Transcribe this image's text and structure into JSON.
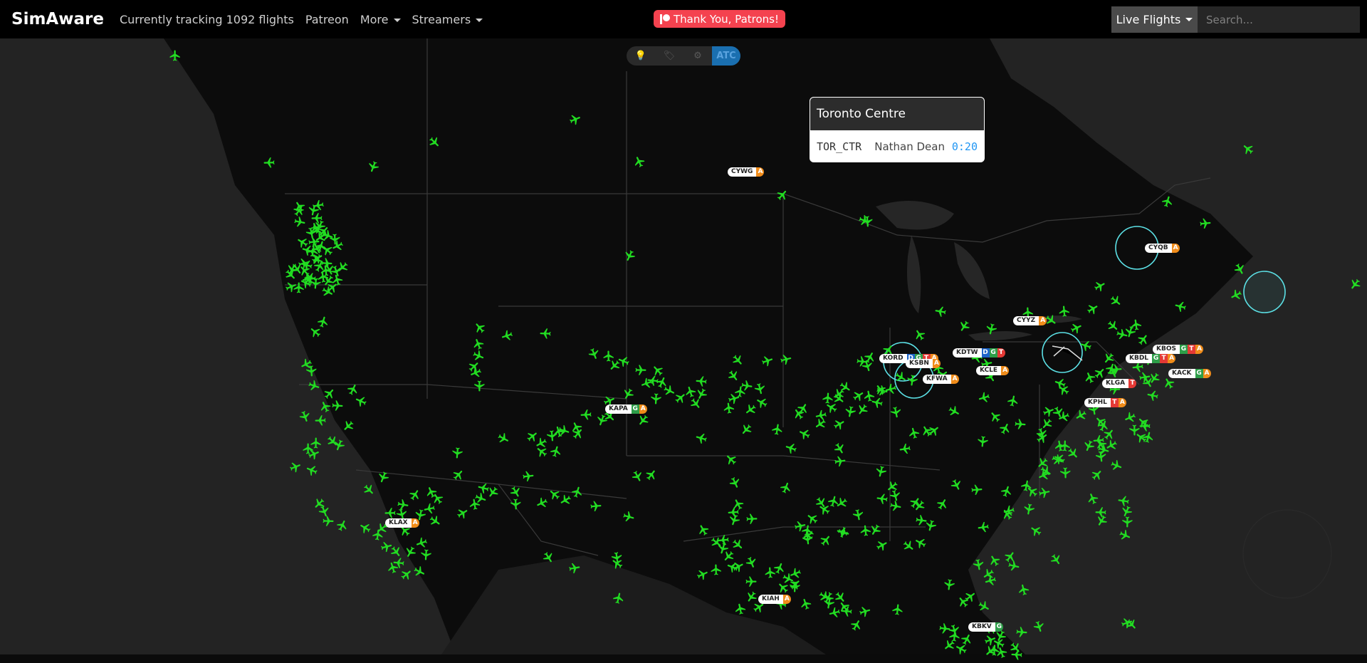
{
  "navbar": {
    "brand": "SimAware",
    "tracking": "Currently tracking 1092 flights",
    "patreon": "Patreon",
    "more": "More",
    "streamers": "Streamers",
    "patron_button": "Thank You, Patrons!",
    "live_flights": "Live Flights",
    "search_placeholder": "Search..."
  },
  "map_toggles": [
    "bulb-icon",
    "tags-icon",
    "gear-icon",
    "ATC"
  ],
  "popup": {
    "title": "Toronto Centre",
    "callsign": "TOR_CTR",
    "controller": "Nathan Dean",
    "time": "0:20"
  },
  "airports": [
    {
      "code": "CYWG",
      "badges": [
        "A"
      ]
    },
    {
      "code": "CYQB",
      "badges": [
        "A"
      ]
    },
    {
      "code": "CYYZ",
      "badges": [
        "A"
      ]
    },
    {
      "code": "KORD",
      "badges": [
        "D",
        "G",
        "T",
        "A"
      ]
    },
    {
      "code": "KSBN",
      "badges": [
        "A"
      ]
    },
    {
      "code": "KDTW",
      "badges": [
        "D",
        "G",
        "T"
      ]
    },
    {
      "code": "KFWA",
      "badges": [
        "A"
      ]
    },
    {
      "code": "KCLE",
      "badges": [
        "A"
      ]
    },
    {
      "code": "KBOS",
      "badges": [
        "G",
        "T",
        "A"
      ]
    },
    {
      "code": "KBDL",
      "badges": [
        "G",
        "T",
        "A"
      ]
    },
    {
      "code": "KACK",
      "badges": [
        "G",
        "A"
      ]
    },
    {
      "code": "KLGA",
      "badges": [
        "T"
      ]
    },
    {
      "code": "KPHL",
      "badges": [
        "T",
        "A"
      ]
    },
    {
      "code": "KAPA",
      "badges": [
        "G",
        "A"
      ]
    },
    {
      "code": "KLAX",
      "badges": [
        "A"
      ]
    },
    {
      "code": "KIAH",
      "badges": [
        "A"
      ]
    },
    {
      "code": "KBKV",
      "badges": [
        "G"
      ]
    }
  ],
  "colors": {
    "plane": "#22dd22",
    "atc_circle": "#5ce1e6",
    "badge_A": "#f08c1a",
    "badge_G": "#2e9e49",
    "badge_T": "#e53935",
    "badge_D": "#1e64c8"
  }
}
